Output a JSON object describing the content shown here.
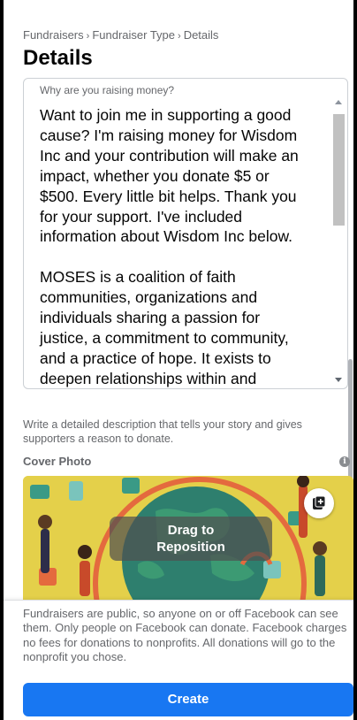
{
  "breadcrumb": {
    "items": [
      "Fundraisers",
      "Fundraiser Type",
      "Details"
    ],
    "separator": "›"
  },
  "page": {
    "title": "Details"
  },
  "description": {
    "label": "Why are you raising money?",
    "text": "Want to join me in supporting a good\ncause? I'm raising money for Wisdom\nInc and your contribution will make an\nimpact, whether you donate $5 or\n$500. Every little bit helps. Thank you\nfor your support. I've included\ninformation about Wisdom Inc below.\n\nMOSES is a coalition of faith\ncommunities, organizations and\nindividuals sharing a passion for\njustice, a commitment to community,\nand a practice of hope. It exists to\ndeepen relationships within and\namong faith communities; and to",
    "helper": "Write a detailed description that tells your story and gives supporters a reason to donate."
  },
  "cover_photo": {
    "label": "Cover Photo",
    "info_icon": "info-icon",
    "drag_hint_line1": "Drag to",
    "drag_hint_line2": "Reposition",
    "add_icon": "add-photo-icon"
  },
  "footer": {
    "disclaimer": "Fundraisers are public, so anyone on or off Facebook can see them. Only people on Facebook can donate. Facebook charges no fees for donations to nonprofits. All donations will go to the nonprofit you chose.",
    "create_label": "Create"
  },
  "colors": {
    "primary": "#1877f2",
    "text_secondary": "#65676b",
    "cover_background": "#e4d04a"
  }
}
